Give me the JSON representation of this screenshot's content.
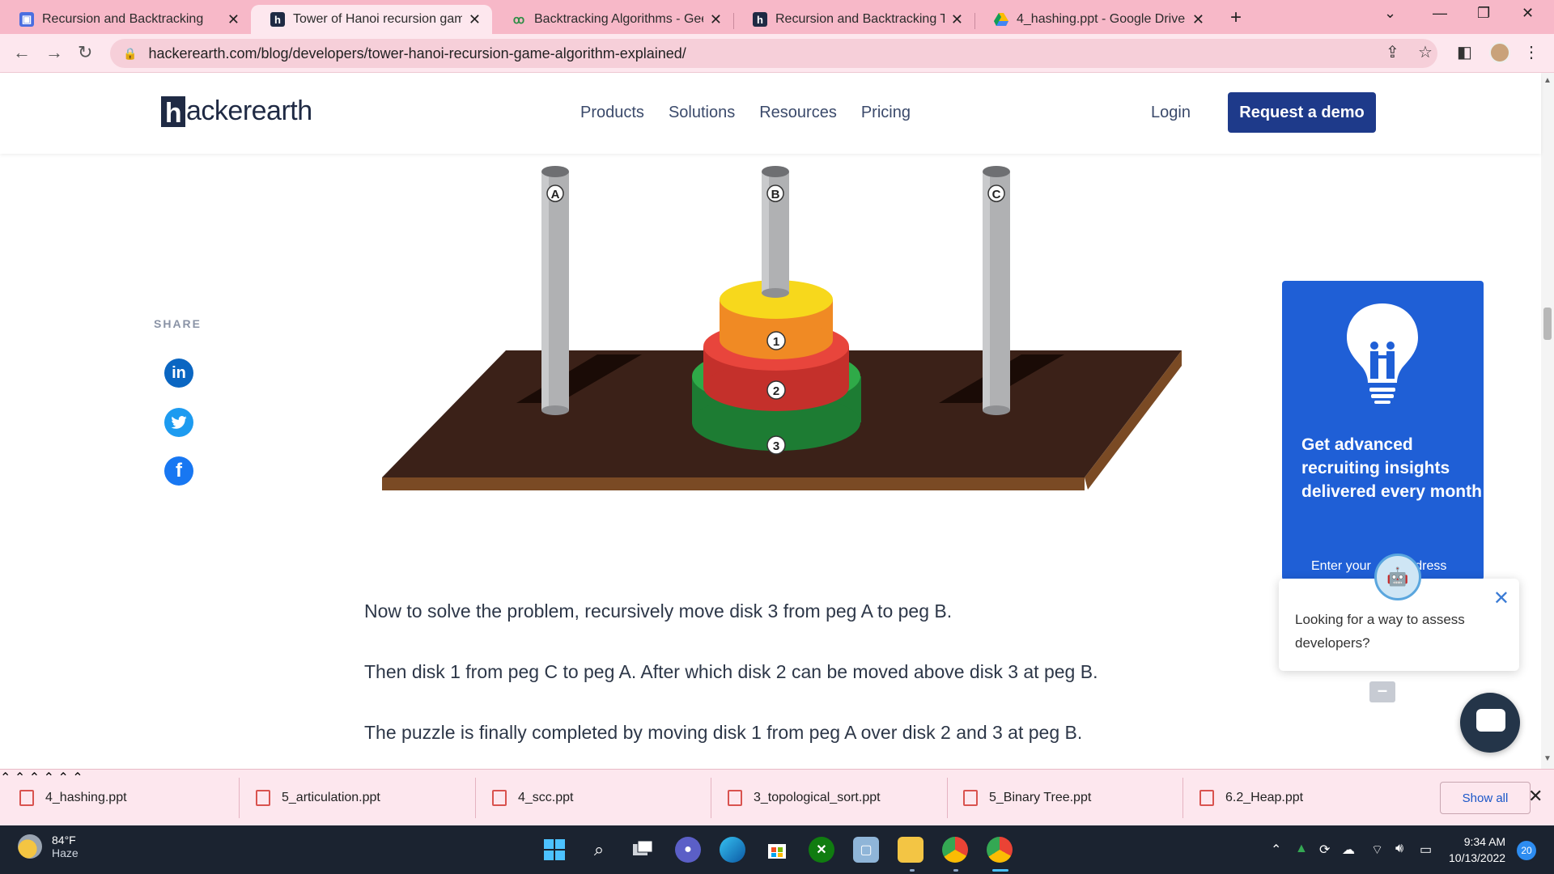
{
  "browser": {
    "tabs": [
      {
        "title": "Recursion and Backtracking",
        "favicon": "hackerearth-blue-icon"
      },
      {
        "title": "Tower of Hanoi recursion game a",
        "favicon": "hackerearth-icon"
      },
      {
        "title": "Backtracking Algorithms - Geeks",
        "favicon": "geeksforgeeks-icon"
      },
      {
        "title": "Recursion and Backtracking Tuto",
        "favicon": "hackerearth-icon"
      },
      {
        "title": "4_hashing.ppt - Google Drive",
        "favicon": "google-drive-icon"
      }
    ],
    "url": "hackerearth.com/blog/developers/tower-hanoi-recursion-game-algorithm-explained/"
  },
  "site": {
    "logo_text": "ackerearth",
    "logo_mark": "h",
    "nav": [
      "Products",
      "Solutions",
      "Resources",
      "Pricing"
    ],
    "login": "Login",
    "demo": "Request a demo",
    "accent": "#1e3a8a"
  },
  "share": {
    "label": "SHARE",
    "icons": [
      "linkedin-icon",
      "twitter-icon",
      "facebook-icon"
    ]
  },
  "illustration": {
    "pegs": [
      "A",
      "B",
      "C"
    ],
    "disks": [
      "1",
      "2",
      "3"
    ]
  },
  "article": {
    "paragraphs": [
      "Now to solve the problem, recursively move disk 3 from peg A to peg B.",
      "Then disk 1 from peg C to peg A. After which disk 2 can be moved above disk 3 at peg B.",
      "The puzzle is finally completed by moving disk 1 from peg A over disk 2 and 3 at peg B."
    ]
  },
  "newsletter": {
    "heading": "Get advanced recruiting insights delivered every month",
    "email_placeholder_visible": "Enter your",
    "email_placeholder_tail": "dress"
  },
  "chat": {
    "message": "Looking for a way to assess developers?"
  },
  "downloads": {
    "items": [
      "4_hashing.ppt",
      "5_articulation.ppt",
      "4_scc.ppt",
      "3_topological_sort.ppt",
      "5_Binary Tree.ppt",
      "6.2_Heap.ppt"
    ],
    "show_all": "Show all"
  },
  "taskbar": {
    "temperature": "84°F",
    "condition": "Haze",
    "time": "9:34 AM",
    "date": "10/13/2022",
    "notifications": "20"
  }
}
